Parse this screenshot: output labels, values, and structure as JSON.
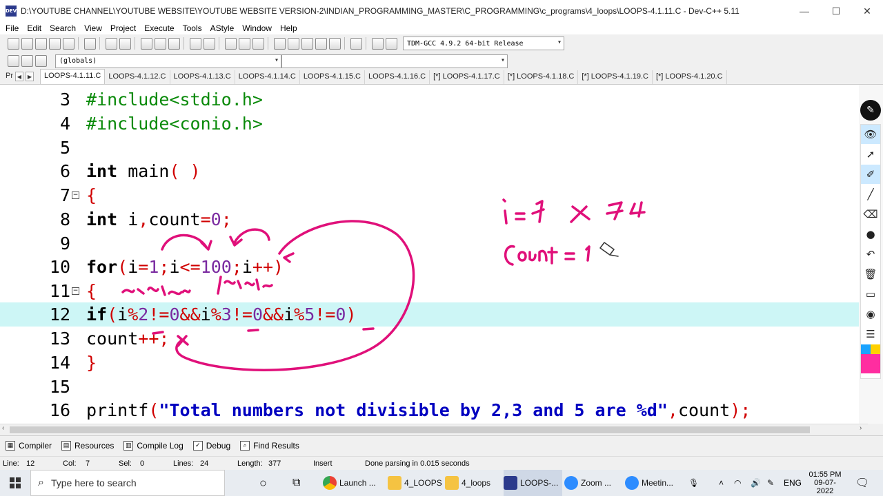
{
  "window": {
    "title": "D:\\YOUTUBE CHANNEL\\YOUTUBE WEBSITE\\YOUTUBE WEBSITE VERSION-2\\INDIAN_PROGRAMMING_MASTER\\C_PROGRAMMING\\c_programs\\4_loops\\LOOPS-4.1.11.C - Dev-C++ 5.11",
    "app_icon_text": "DEV",
    "minimize": "—",
    "maximize": "☐",
    "close": "✕"
  },
  "menu": [
    "File",
    "Edit",
    "Search",
    "View",
    "Project",
    "Execute",
    "Tools",
    "AStyle",
    "Window",
    "Help"
  ],
  "toolbar": {
    "compiler_select": "TDM-GCC 4.9.2 64-bit Release",
    "scope_select": "(globals)"
  },
  "tabs": {
    "project_label": "Pr",
    "items": [
      "LOOPS-4.1.11.C",
      "LOOPS-4.1.12.C",
      "LOOPS-4.1.13.C",
      "LOOPS-4.1.14.C",
      "LOOPS-4.1.15.C",
      "LOOPS-4.1.16.C",
      "[*] LOOPS-4.1.17.C",
      "[*] LOOPS-4.1.18.C",
      "[*] LOOPS-4.1.19.C",
      "[*] LOOPS-4.1.20.C"
    ]
  },
  "code": {
    "line_numbers": [
      "3",
      "4",
      "5",
      "6",
      "7",
      "8",
      "9",
      "10",
      "11",
      "12",
      "13",
      "14",
      "15",
      "16"
    ],
    "l3": "#include<stdio.h>",
    "l4": "#include<conio.h>",
    "l6_kw": "int",
    "l6_name": " main",
    "l6_paren": "( )",
    "l7": "{",
    "l8_kw": "int",
    "l8_a": " i",
    "l8_b": ",",
    "l8_c": "count",
    "l8_d": "=",
    "l8_e": "0",
    "l8_f": ";",
    "l10_kw": "for",
    "l10_a": "(",
    "l10_b": "i",
    "l10_c": "=",
    "l10_d": "1",
    "l10_e": ";",
    "l10_f": "i",
    "l10_g": "<=",
    "l10_h": "100",
    "l10_i": ";",
    "l10_j": "i",
    "l10_k": "++)",
    "l11": "{",
    "l12_kw": "if",
    "l12_a": "(",
    "l12_b": "i",
    "l12_c": "%",
    "l12_d": "2",
    "l12_e": "!=",
    "l12_f": "0",
    "l12_g": "&&",
    "l12_h": "i",
    "l12_i": "%",
    "l12_j": "3",
    "l12_k": "!=",
    "l12_l": "0",
    "l12_m": "&&",
    "l12_n": "i",
    "l12_o": "%",
    "l12_p": "5",
    "l12_q": "!=",
    "l12_r": "0",
    "l12_s": ")",
    "l13_a": "count",
    "l13_b": "++;",
    "l14": "}",
    "l16_a": "printf",
    "l16_b": "(",
    "l16_c": "\"Total numbers not divisible by 2,3 and 5 are %d\"",
    "l16_d": ",",
    "l16_e": "count",
    "l16_f": ");"
  },
  "annotations": {
    "ink_color": "#e0107a"
  },
  "bottom_tabs": [
    "Compiler",
    "Resources",
    "Compile Log",
    "Debug",
    "Find Results"
  ],
  "status": {
    "line": "Line:",
    "line_val": "12",
    "col": "Col:",
    "col_val": "7",
    "sel": "Sel:",
    "sel_val": "0",
    "lines": "Lines:",
    "lines_val": "24",
    "length": "Length:",
    "length_val": "377",
    "mode": "Insert",
    "message": "Done parsing in 0.015 seconds"
  },
  "taskbar": {
    "search_placeholder": "Type here to search",
    "apps": [
      "Launch ...",
      "4_LOOPS",
      "4_loops",
      "LOOPS-...",
      "Zoom ...",
      "Meetin..."
    ],
    "lang": "ENG",
    "time": "01:55 PM",
    "date": "09-07-2022"
  }
}
